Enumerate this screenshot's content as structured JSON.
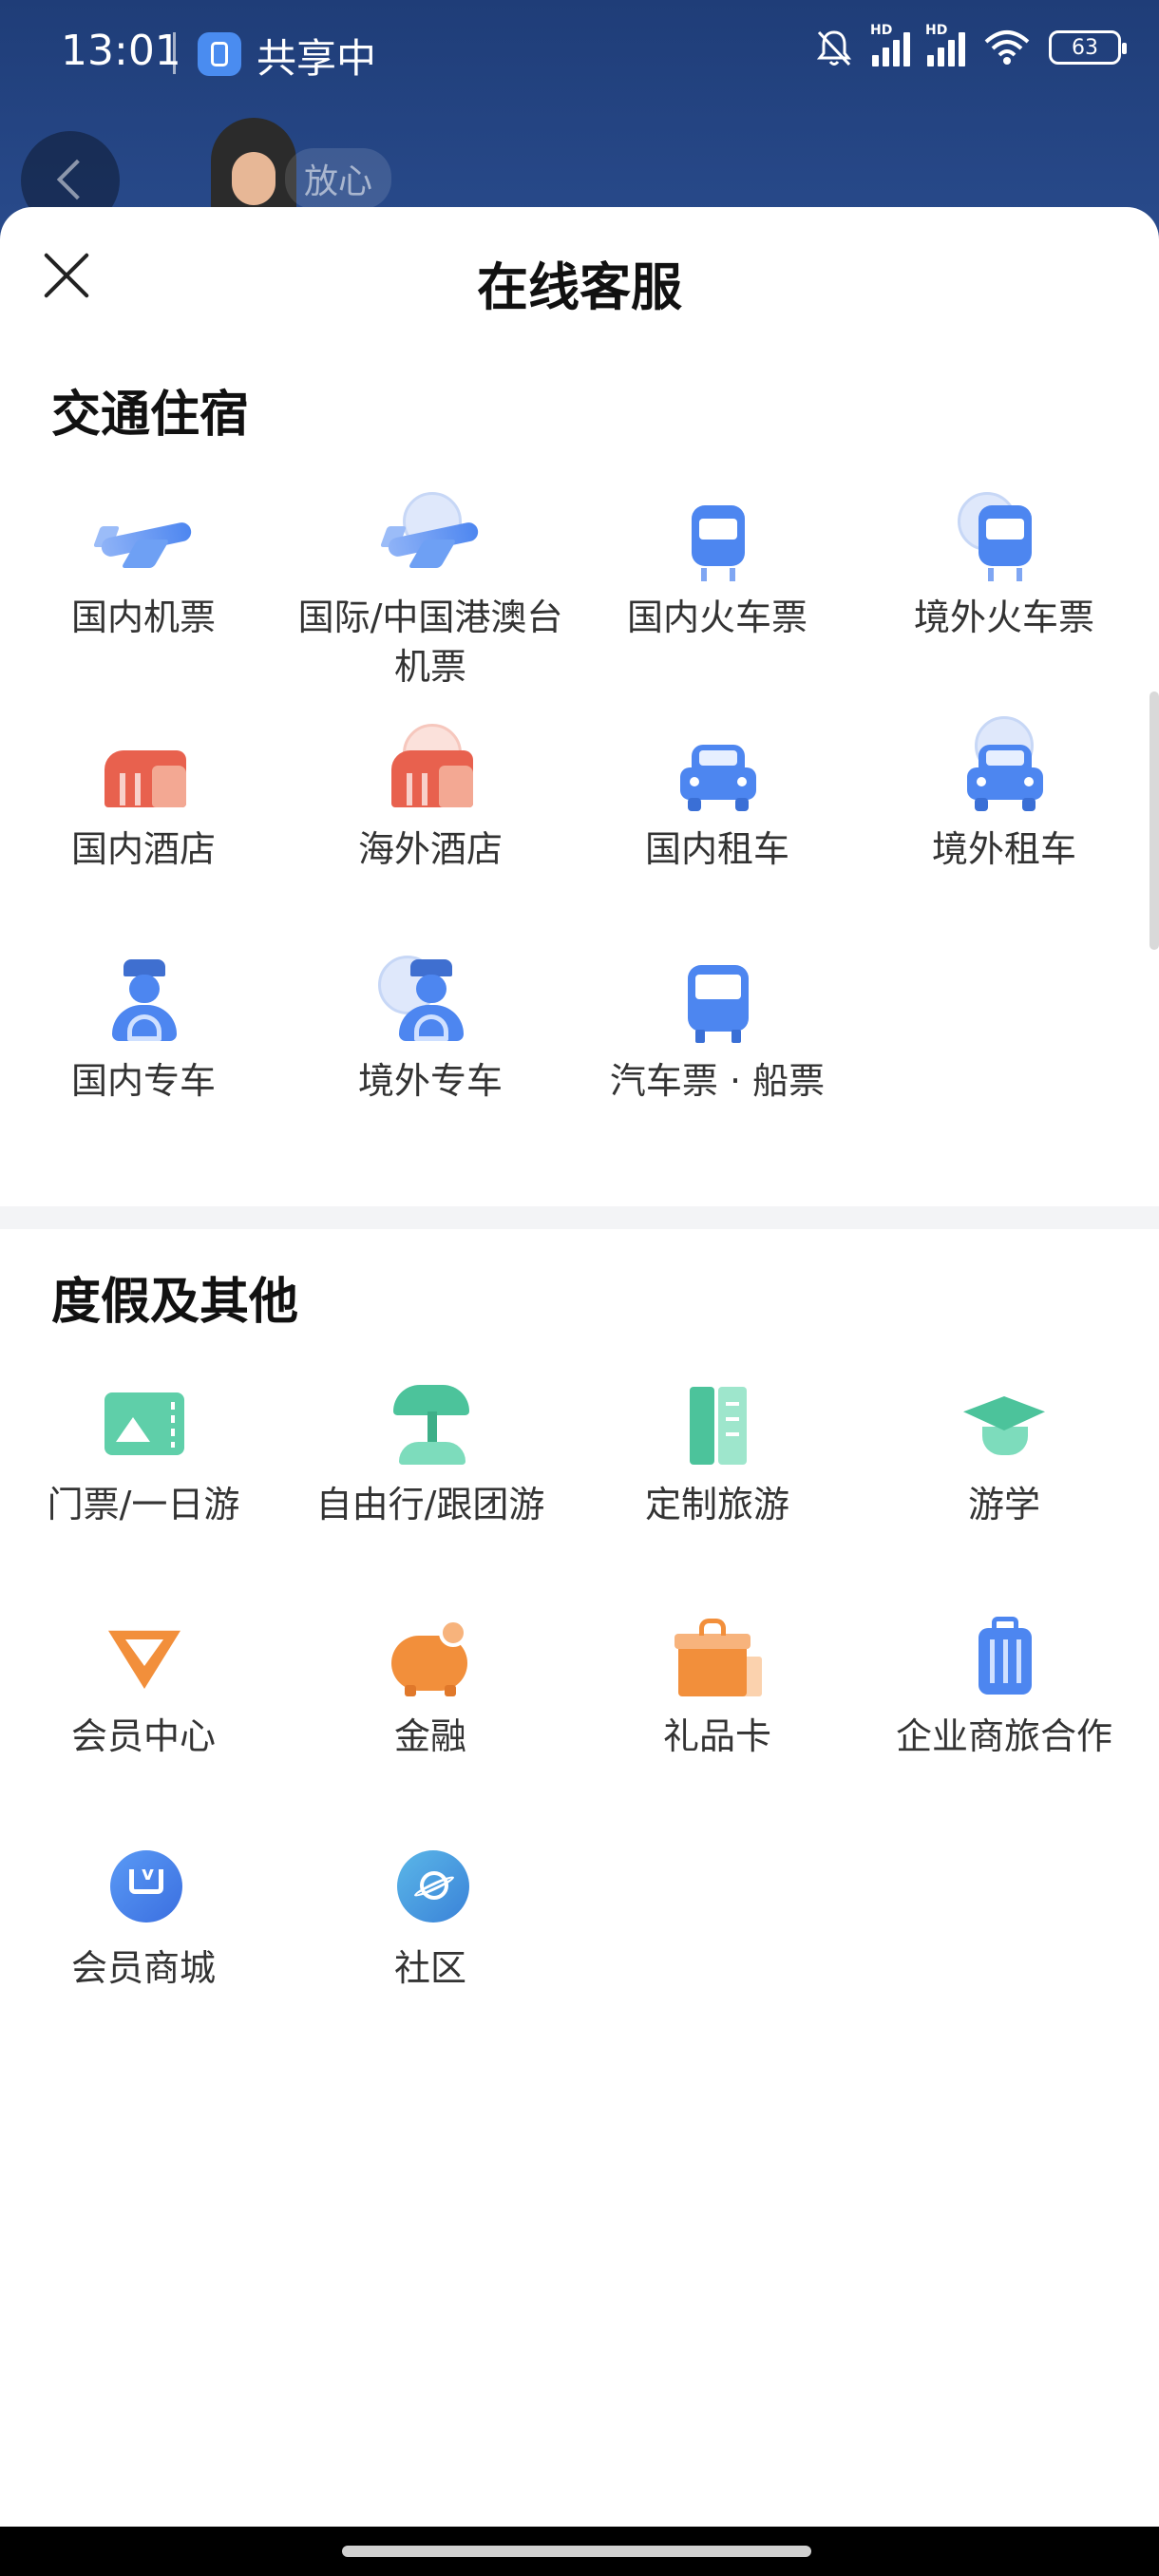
{
  "status_bar": {
    "time": "13:01",
    "sharing_label": "共享中",
    "signal_badge_1": "HD",
    "signal_badge_2": "HD",
    "battery": "63"
  },
  "background": {
    "agent_tag": "放心"
  },
  "sheet": {
    "title": "在线客服"
  },
  "sections": [
    {
      "title": "交通住宿",
      "items": [
        {
          "label": "国内机票",
          "icon": "plane-icon"
        },
        {
          "label": "国际/中国港澳台机票",
          "icon": "international-plane-icon"
        },
        {
          "label": "国内火车票",
          "icon": "train-icon"
        },
        {
          "label": "境外火车票",
          "icon": "international-train-icon"
        },
        {
          "label": "国内酒店",
          "icon": "hotel-icon"
        },
        {
          "label": "海外酒店",
          "icon": "overseas-hotel-icon"
        },
        {
          "label": "国内租车",
          "icon": "car-icon"
        },
        {
          "label": "境外租车",
          "icon": "overseas-car-icon"
        },
        {
          "label": "国内专车",
          "icon": "driver-icon"
        },
        {
          "label": "境外专车",
          "icon": "overseas-driver-icon"
        },
        {
          "label": "汽车票 · 船票",
          "icon": "bus-icon"
        }
      ]
    },
    {
      "title": "度假及其他",
      "items": [
        {
          "label": "门票/一日游",
          "icon": "ticket-icon"
        },
        {
          "label": "自由行/跟团游",
          "icon": "palm-tree-icon"
        },
        {
          "label": "定制旅游",
          "icon": "custom-tour-icon"
        },
        {
          "label": "游学",
          "icon": "graduation-cap-icon"
        },
        {
          "label": "会员中心",
          "icon": "vip-icon"
        },
        {
          "label": "金融",
          "icon": "piggy-bank-icon"
        },
        {
          "label": "礼品卡",
          "icon": "gift-card-icon"
        },
        {
          "label": "企业商旅合作",
          "icon": "luggage-icon"
        },
        {
          "label": "会员商城",
          "icon": "shopping-cart-icon"
        },
        {
          "label": "社区",
          "icon": "planet-icon"
        }
      ]
    }
  ],
  "colors": {
    "header_bg": "#1f3d78",
    "transport_icon_blue": "#4d86f0",
    "hotel_icon_red": "#e8614e",
    "vacation_icon_green": "#4cc39b",
    "other_icon_orange": "#f28f3b"
  }
}
